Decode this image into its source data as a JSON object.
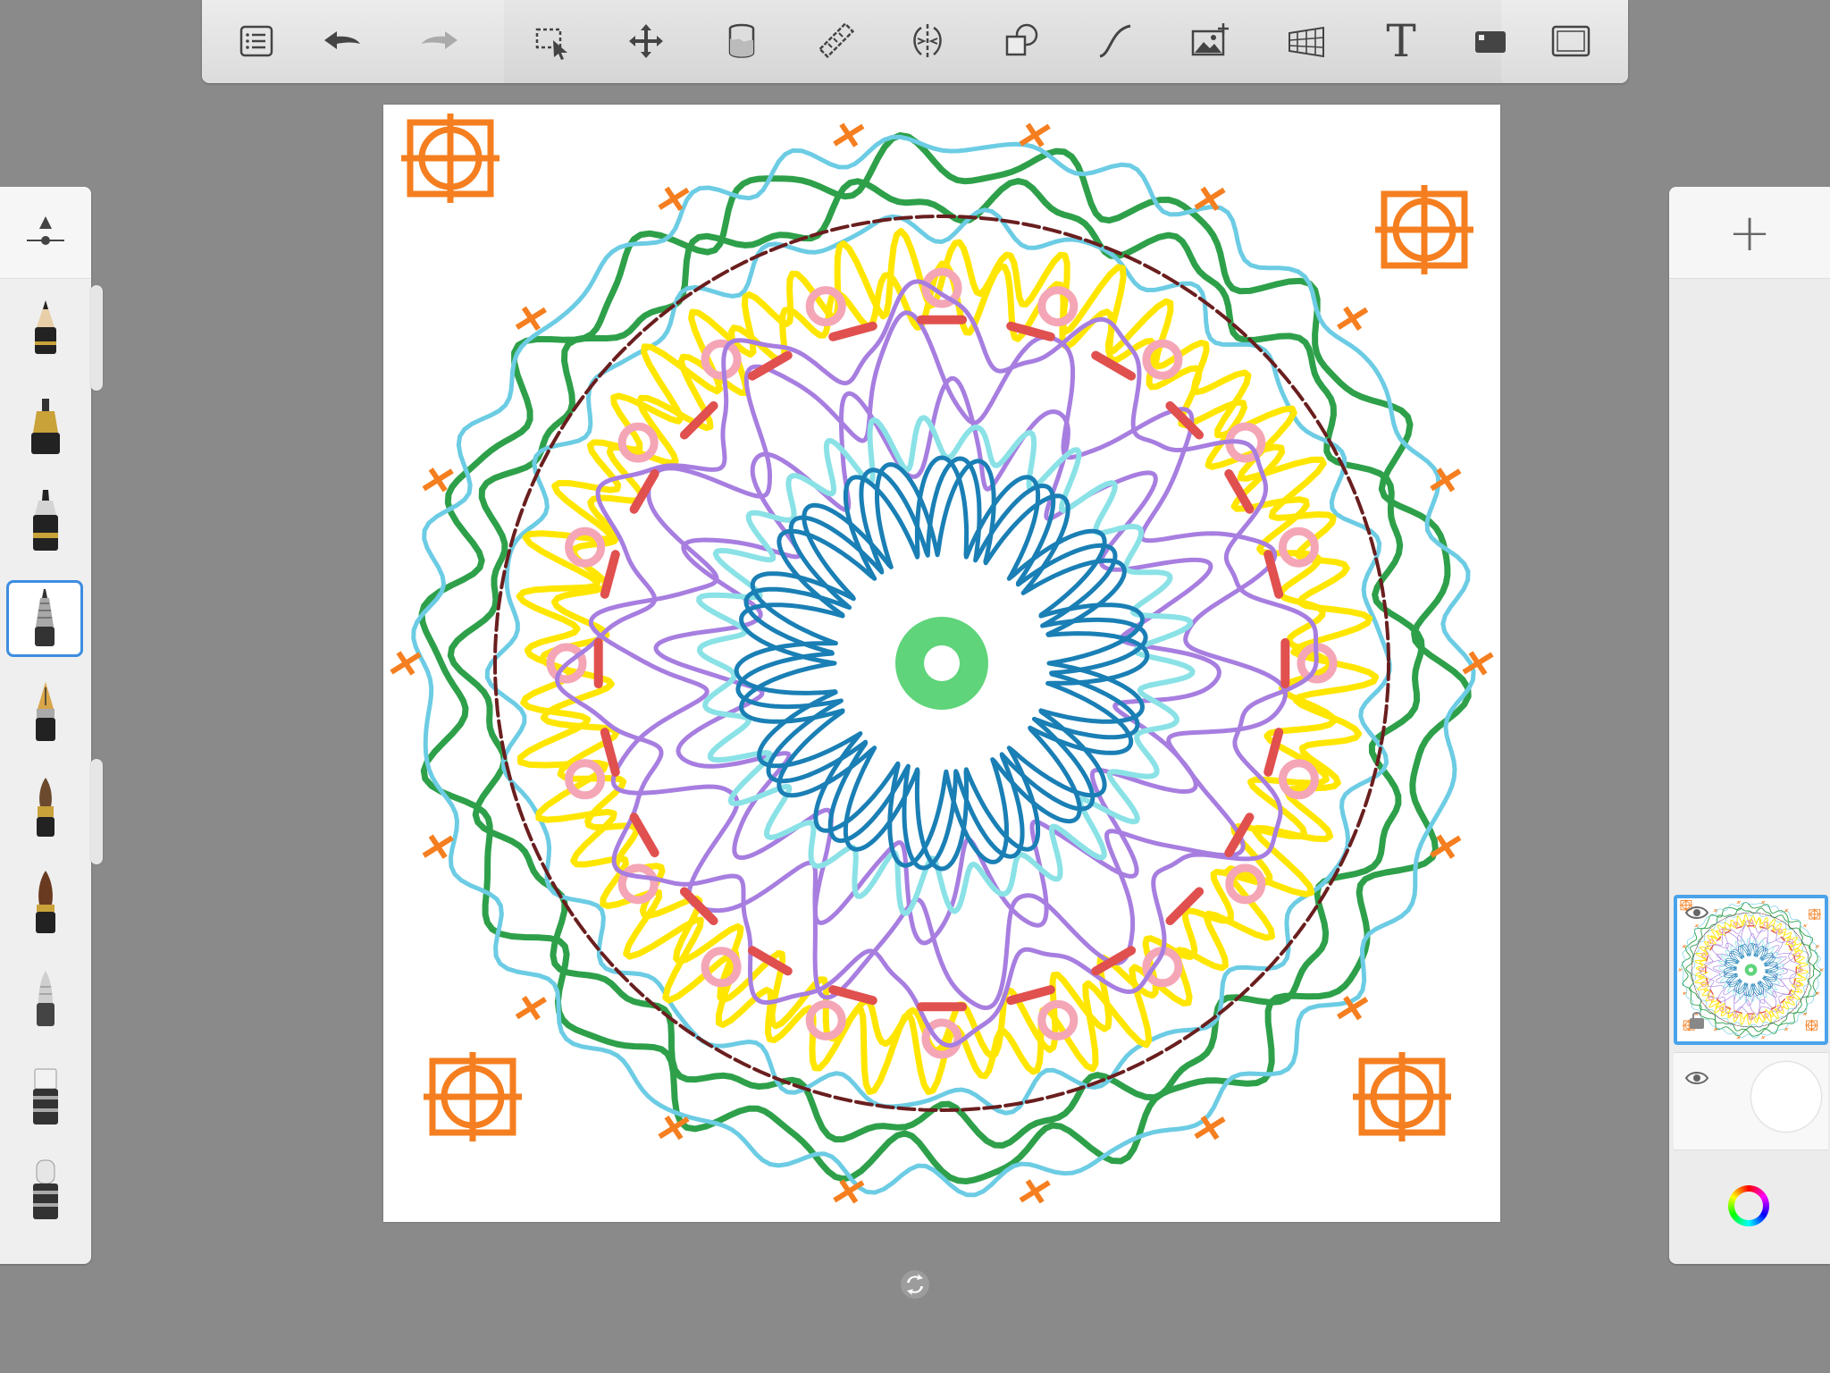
{
  "toolbar": {
    "items": [
      {
        "id": "menu",
        "icon": "list-menu-icon"
      },
      {
        "id": "undo",
        "icon": "undo-arrow-icon"
      },
      {
        "id": "redo",
        "icon": "redo-arrow-icon"
      },
      {
        "id": "selection",
        "icon": "selection-icon"
      },
      {
        "id": "transform",
        "icon": "move-arrows-icon"
      },
      {
        "id": "fill",
        "icon": "paint-bucket-icon"
      },
      {
        "id": "ruler",
        "icon": "ruler-icon"
      },
      {
        "id": "symmetry",
        "icon": "symmetry-icon"
      },
      {
        "id": "shapes",
        "icon": "shapes-icon"
      },
      {
        "id": "stroke",
        "icon": "curve-icon"
      },
      {
        "id": "image",
        "icon": "add-image-icon"
      },
      {
        "id": "perspective",
        "icon": "perspective-grid-icon"
      },
      {
        "id": "text",
        "icon": "text-icon",
        "label": "T"
      },
      {
        "id": "layers-toggle",
        "icon": "canvas-toggle-icon"
      },
      {
        "id": "fullscreen",
        "icon": "fullscreen-icon"
      }
    ]
  },
  "brushes": {
    "items": [
      "pencil",
      "marker",
      "felt-pen",
      "ballpoint-pen",
      "fountain-pen",
      "paintbrush",
      "ink-brush",
      "airbrush",
      "eraser",
      "soft-eraser"
    ],
    "selected": "ballpoint-pen"
  },
  "layers": {
    "add_label": "+",
    "items": [
      {
        "name": "drawing-layer",
        "visible": true,
        "selected": true
      },
      {
        "name": "background-layer",
        "visible": true,
        "selected": false
      }
    ]
  },
  "colors": {
    "accent": "#3d8de0",
    "stroke_palette": [
      "#f57f20",
      "#2ea04a",
      "#6ccce4",
      "#ffe600",
      "#f4a6b6",
      "#a77ee0",
      "#e0504f",
      "#1a7fb5",
      "#5fd47a",
      "#6a1e1e",
      "#8ae2e6"
    ]
  }
}
